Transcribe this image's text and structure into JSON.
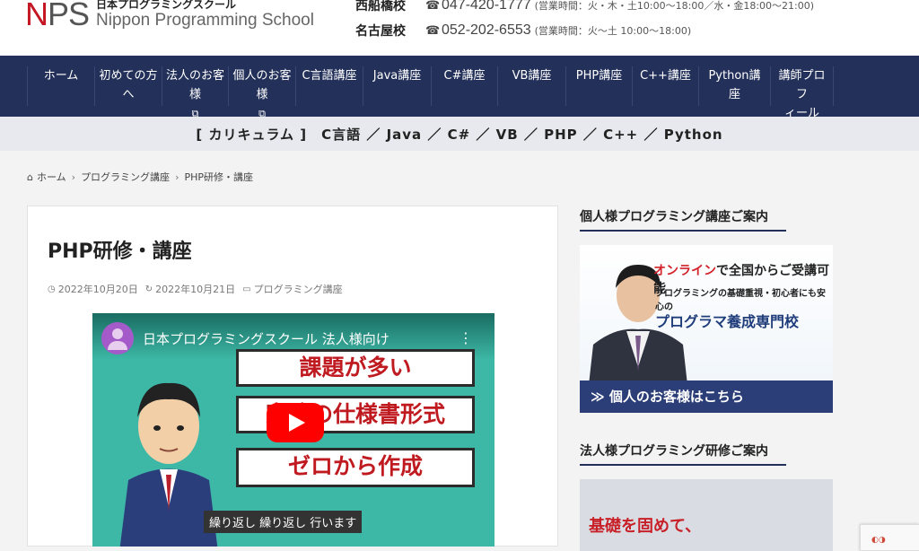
{
  "header": {
    "logo_n": "N",
    "logo_ps": "PS",
    "logo_jp": "日本プログラミングスクール",
    "logo_en": "Nippon Programming School",
    "contacts": [
      {
        "campus": "西船橋校",
        "phone": "047-420-1777",
        "hours": "(営業時間：火・木・土10:00～18:00／水・金18:00～21:00)"
      },
      {
        "campus": "名古屋校",
        "phone": "052-202-6553",
        "hours": "(営業時間：火～土 10:00～18:00)"
      }
    ]
  },
  "nav": {
    "items": [
      {
        "label": "ホーム",
        "line2": ""
      },
      {
        "label": "初めての方",
        "line2": "へ"
      },
      {
        "label": "法人のお客",
        "line2": "様"
      },
      {
        "label": "個人のお客",
        "line2": "様"
      },
      {
        "label": "C言語講座",
        "line2": ""
      },
      {
        "label": "Java講座",
        "line2": ""
      },
      {
        "label": "C#講座",
        "line2": ""
      },
      {
        "label": "VB講座",
        "line2": ""
      },
      {
        "label": "PHP講座",
        "line2": ""
      },
      {
        "label": "C++講座",
        "line2": ""
      },
      {
        "label": "Python講座",
        "line2": ""
      },
      {
        "label": "講師プロフ",
        "line2": "ィール"
      }
    ]
  },
  "curriculum_bar": "[ カリキュラム ]　C言語 ／ Java ／ C# ／ VB ／ PHP ／ C++ ／ Python",
  "breadcrumb": {
    "home": "ホーム",
    "category": "プログラミング講座",
    "current": "PHP研修・講座"
  },
  "article": {
    "title": "PHP研修・講座",
    "published": "2022年10月20日",
    "updated": "2022年10月21日",
    "category": "プログラミング講座"
  },
  "video": {
    "title": "日本プログラミングスクール 法人様向け",
    "box1": "課題が多い",
    "box2": "実務の仕様書形式",
    "box3": "ゼロから作成",
    "caption": "繰り返し 繰り返し 行います"
  },
  "sidebar": {
    "heading1": "個人様プログラミング講座ご案内",
    "banner1_line1_red": "オンライン",
    "banner1_line1_rest": "で全国からご受講可能",
    "banner1_line2": "プログラミングの基礎重視・初心者にも安心の",
    "banner1_line3": "プログラマ養成専門校",
    "banner1_cta": "≫ 個人のお客様はこちら",
    "heading2": "法人様プログラミング研修ご案内",
    "banner2_text": "基礎を固めて、"
  },
  "colors": {
    "nav_bg": "#233059",
    "brand_red": "#c41623"
  }
}
